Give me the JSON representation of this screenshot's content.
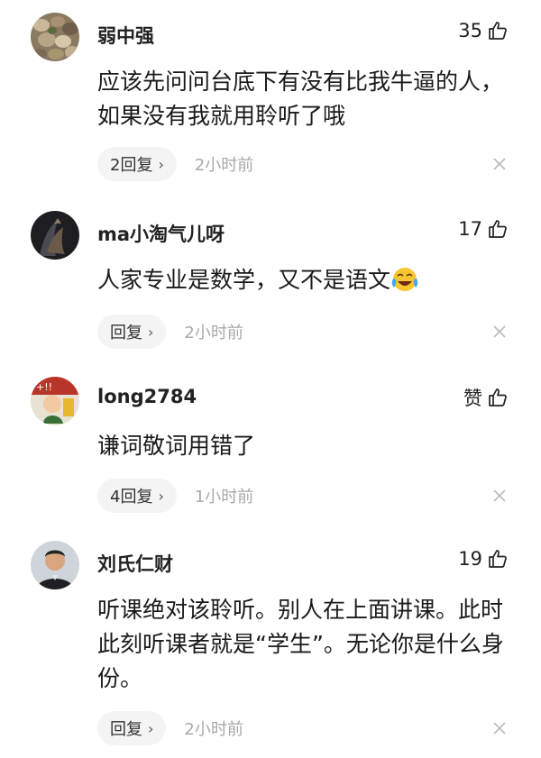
{
  "comments": [
    {
      "username": "弱中强",
      "likes": "35",
      "text": "应该先问问台底下有没有比我牛逼的人，如果没有我就用聆听了哦",
      "reply_label": "2回复",
      "time": "2小时前",
      "avatar_icon": "pebbles-avatar"
    },
    {
      "username": "ma小淘气儿呀",
      "likes": "17",
      "text": "人家专业是数学，又不是语文",
      "reply_label": "回复",
      "time": "2小时前",
      "avatar_icon": "dark-portrait-avatar",
      "emoji": "crying-laughing-emoji"
    },
    {
      "username": "long2784",
      "likes": "赞",
      "text": "谦词敬词用错了",
      "reply_label": "4回复",
      "time": "1小时前",
      "avatar_icon": "cartoon-avatar"
    },
    {
      "username": "刘氏仁财",
      "likes": "19",
      "text": "听课绝对该聆听。别人在上面讲课。此时此刻听课者就是“学生”。无论你是什么身份。",
      "reply_label": "回复",
      "time": "2小时前",
      "avatar_icon": "man-portrait-avatar"
    }
  ],
  "colors": {
    "text": "#1a1a1a",
    "muted": "#a8a8a8",
    "pill_bg": "#f4f4f4"
  }
}
